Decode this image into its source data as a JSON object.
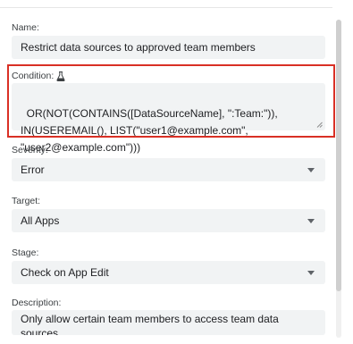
{
  "name": {
    "label": "Name:",
    "value": "Restrict data sources to approved team members"
  },
  "condition": {
    "label": "Condition:",
    "icon": "flask-icon",
    "value": "OR(NOT(CONTAINS([DataSourceName], \":Team:\")), IN(USEREMAIL(), LIST(\"user1@example.com\", \"user2@example.com\")))"
  },
  "severity": {
    "label": "Severity:",
    "value": "Error"
  },
  "target": {
    "label": "Target:",
    "value": "All Apps"
  },
  "stage": {
    "label": "Stage:",
    "value": "Check on App Edit"
  },
  "description": {
    "label": "Description:",
    "value": "Only allow certain team members to access team data sources"
  },
  "colors": {
    "highlight": "#d93025",
    "field_bg": "#f1f3f4"
  }
}
